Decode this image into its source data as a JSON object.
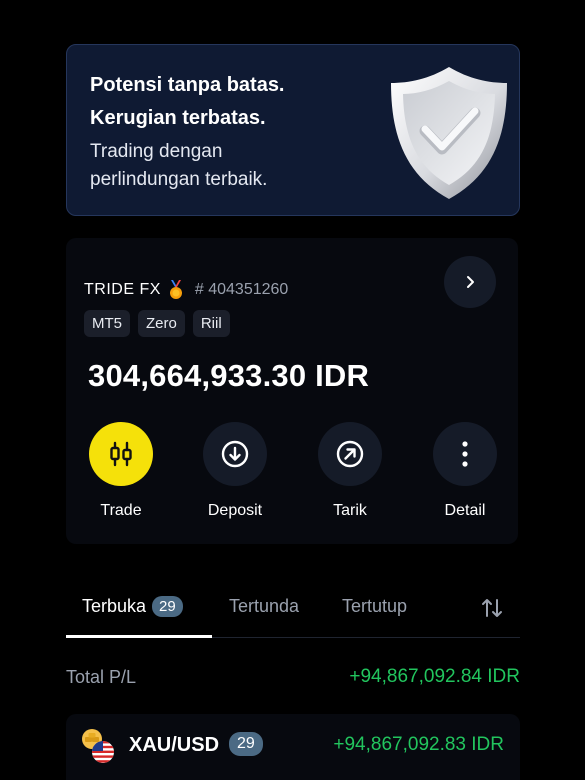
{
  "banner": {
    "headline_1": "Potensi tanpa batas.",
    "headline_2": "Kerugian terbatas.",
    "sub_1": "Trading dengan",
    "sub_2": "perlindungan terbaik."
  },
  "account": {
    "name": "TRIDE FX",
    "number": "# 404351260",
    "tags": [
      "MT5",
      "Zero",
      "Riil"
    ],
    "balance": "304,664,933.30 IDR",
    "actions": [
      {
        "label": "Trade",
        "icon": "candlestick-icon"
      },
      {
        "label": "Deposit",
        "icon": "arrow-down-circle-icon"
      },
      {
        "label": "Tarik",
        "icon": "arrow-up-right-circle-icon"
      },
      {
        "label": "Detail",
        "icon": "more-vertical-icon"
      }
    ]
  },
  "tabs": {
    "open_label": "Terbuka",
    "open_count": "29",
    "pending_label": "Tertunda",
    "closed_label": "Tertutup"
  },
  "totals": {
    "label": "Total P/L",
    "value": "+94,867,092.84 IDR"
  },
  "positions": [
    {
      "symbol": "XAU/USD",
      "count": "29",
      "pl": "+94,867,092.83 IDR"
    }
  ],
  "colors": {
    "accent_yellow": "#f5e10a",
    "profit_green": "#22c55e",
    "badge_blue": "#4b6a84",
    "banner_bg": "#0f1a33"
  }
}
